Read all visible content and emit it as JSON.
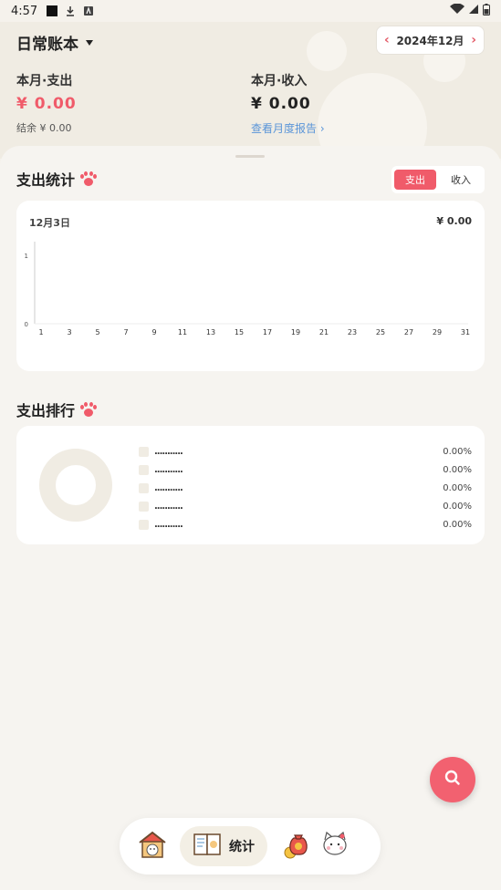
{
  "status": {
    "time": "4:57"
  },
  "header": {
    "book_title": "日常账本",
    "month": "2024年12月",
    "expense_label": "本月·支出",
    "expense_amount": "¥ 0.00",
    "balance": "结余  ¥ 0.00",
    "income_label": "本月·收入",
    "income_amount": "¥ 0.00",
    "report_link": "查看月度报告 ›"
  },
  "stats": {
    "title": "支出统计",
    "toggle": [
      "支出",
      "收入"
    ],
    "date": "12月3日",
    "total": "¥ 0.00"
  },
  "chart_data": {
    "type": "line",
    "x": [
      "1",
      "3",
      "5",
      "7",
      "9",
      "11",
      "13",
      "15",
      "17",
      "19",
      "21",
      "23",
      "25",
      "27",
      "29",
      "31"
    ],
    "yticks": [
      "0",
      "1"
    ],
    "series": [
      {
        "values": [
          0,
          0,
          0,
          0,
          0,
          0,
          0,
          0,
          0,
          0,
          0,
          0,
          0,
          0,
          0,
          0
        ]
      }
    ],
    "ylim": [
      0,
      1
    ]
  },
  "ranking": {
    "title": "支出排行",
    "rows": [
      {
        "name": "...........",
        "pct": "0.00%"
      },
      {
        "name": "...........",
        "pct": "0.00%"
      },
      {
        "name": "...........",
        "pct": "0.00%"
      },
      {
        "name": "...........",
        "pct": "0.00%"
      },
      {
        "name": "...........",
        "pct": "0.00%"
      }
    ]
  },
  "tabbar": {
    "active_label": "统计"
  },
  "colors": {
    "accent": "#f05b6a",
    "link": "#5a95d8",
    "bg": "#f5f2ec"
  },
  "icons": [
    "search-icon",
    "home-cat-icon",
    "book-icon",
    "money-bag-icon",
    "cat-profile-icon",
    "paw-icon"
  ]
}
